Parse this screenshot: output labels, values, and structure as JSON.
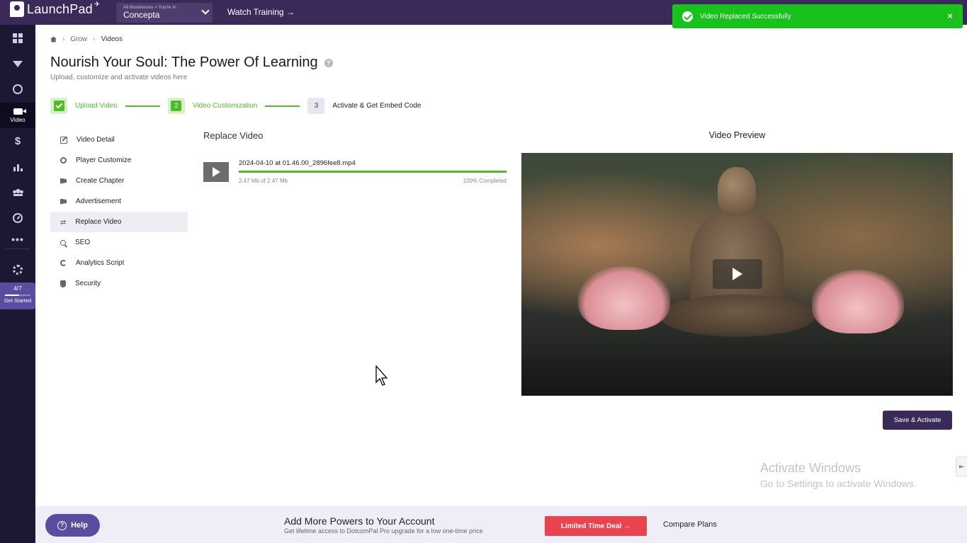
{
  "app": {
    "logo_text": "LaunchPad",
    "business_selector": {
      "small_label": "All Businesses > You're In",
      "value": "Concepta"
    },
    "watch_training": "Watch Training →"
  },
  "toast": {
    "message": "Video Replaced Successfully",
    "close": "×",
    "color": "#18c21a"
  },
  "sidebar": {
    "items": [
      {
        "icon": "grid-icon"
      },
      {
        "icon": "funnel-icon"
      },
      {
        "icon": "globe-icon"
      },
      {
        "icon": "video-icon",
        "label": "Video",
        "active": true
      },
      {
        "icon": "dollar-icon"
      },
      {
        "icon": "bar-chart-icon"
      },
      {
        "icon": "users-icon"
      },
      {
        "icon": "gauge-icon"
      },
      {
        "icon": "more-icon"
      },
      {
        "icon": "gear-icon"
      }
    ],
    "dollar_glyph": "$",
    "dots_glyph": "•••",
    "get_started": {
      "progress": "4/7",
      "label": "Get Started",
      "progress_fraction": 0.57
    }
  },
  "breadcrumb": {
    "items": [
      "Grow",
      "Videos"
    ],
    "separator": "›"
  },
  "page": {
    "title": "Nourish Your Soul: The Power Of Learning",
    "help_glyph": "?",
    "subtitle": "Upload, customize and activate videos here"
  },
  "stepper": {
    "steps": [
      {
        "number": "1",
        "label": "Upload Video",
        "state": "done"
      },
      {
        "number": "2",
        "label": "Video Customization",
        "state": "current"
      },
      {
        "number": "3",
        "label": "Activate & Get Embed Code",
        "state": "pending"
      }
    ]
  },
  "menu": {
    "items": [
      {
        "label": "Video Detail",
        "icon": "edit-icon"
      },
      {
        "label": "Player Customize",
        "icon": "palette-icon"
      },
      {
        "label": "Create Chapter",
        "icon": "megaphone-icon"
      },
      {
        "label": "Advertisement",
        "icon": "megaphone-icon"
      },
      {
        "label": "Replace Video",
        "icon": "swap-icon",
        "active": true
      },
      {
        "label": "SEO",
        "icon": "search-icon"
      },
      {
        "label": "Analytics Script",
        "icon": "pie-icon"
      },
      {
        "label": "Security",
        "icon": "shield-icon"
      }
    ],
    "swap_glyph": "⇄"
  },
  "replace_video": {
    "title": "Replace Video",
    "file_name": "2024-04-10 at 01.46.00_2896fee8.mp4",
    "size_text": "2.47 Mb of 2.47 Mb",
    "percent_text": "100% Completed",
    "progress": 1.0
  },
  "preview": {
    "title": "Video Preview"
  },
  "actions": {
    "save_activate": "Save & Activate"
  },
  "watermark": {
    "title": "Activate Windows",
    "subtitle": "Go to Settings to activate Windows."
  },
  "side_tab_glyph": "⇤",
  "bottom": {
    "help": "Help",
    "help_glyph": "?",
    "promo_title": "Add More Powers to Your Account",
    "promo_sub": "Get lifetime access to DotcomPal Pro upgrade for a low one-time price",
    "deal_button": "Limited Time Deal →",
    "compare": "Compare Plans"
  },
  "colors": {
    "brand": "#3a2a5a",
    "accent_green": "#4fba2a",
    "deal_red": "#e9434f",
    "help_purple": "#5a4c9e"
  }
}
